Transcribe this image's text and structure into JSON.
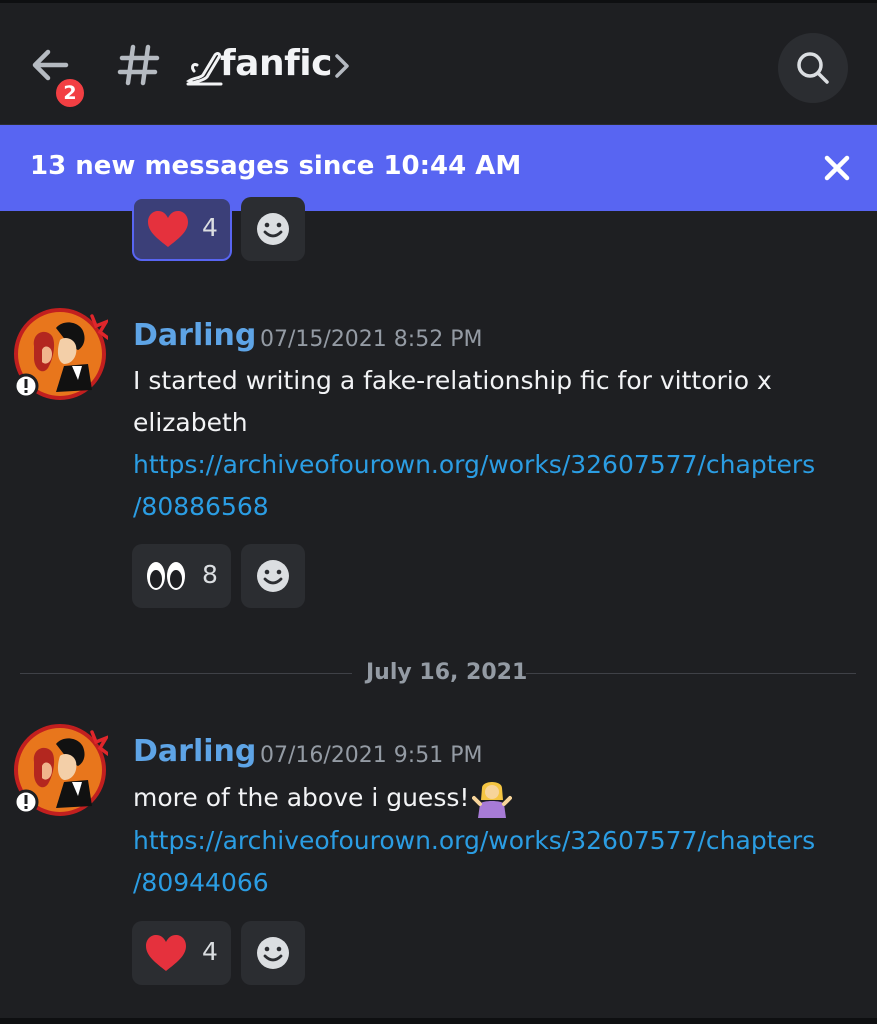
{
  "header": {
    "unread_badge": "2",
    "channel_name": "fanfic",
    "icons": {
      "back": "arrow-left-icon",
      "hash": "hash-icon",
      "channel_emoji": "writing-hand-icon",
      "chevron": "chevron-right-icon",
      "search": "search-icon"
    }
  },
  "new_messages_bar": {
    "text": "13 new messages since 10:44 AM",
    "close_icon": "close-icon",
    "color": "#5865f2"
  },
  "top_reactions": [
    {
      "emoji": "red-heart",
      "count": "4",
      "selected": true
    }
  ],
  "messages": [
    {
      "author": "Darling",
      "timestamp": "07/15/2021 8:52 PM",
      "text_line1": "I started writing a fake-relationship fic for vittorio x",
      "text_line2": "elizabeth",
      "link_line1": "https://archiveofourown.org/works/32607577/chapters",
      "link_line2": "/80886568",
      "reactions": [
        {
          "emoji": "eyes",
          "count": "8",
          "selected": false
        }
      ]
    },
    {
      "author": "Darling",
      "timestamp": "07/16/2021 9:51 PM",
      "text_line1": "more of the above i guess!",
      "text_emoji": "person-shrugging",
      "link_line1": "https://archiveofourown.org/works/32607577/chapters",
      "link_line2": "/80944066",
      "reactions": [
        {
          "emoji": "red-heart",
          "count": "4",
          "selected": false
        }
      ]
    }
  ],
  "date_divider": "July 16, 2021",
  "colors": {
    "background": "#1e1f22",
    "username": "#5ea4e6",
    "link": "#2b9de3",
    "accent": "#5865f2",
    "badge": "#f23f43"
  }
}
